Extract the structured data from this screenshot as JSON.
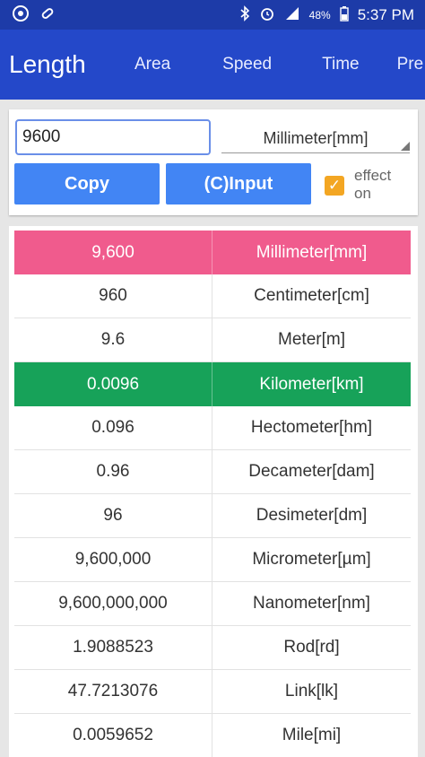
{
  "status": {
    "time": "5:37 PM",
    "battery": "48%",
    "left_icons": [
      "app-icon",
      "link-icon"
    ],
    "right_icons": [
      "bluetooth-icon",
      "alarm-icon",
      "signal-icon",
      "battery-icon"
    ]
  },
  "appbar": {
    "title": "Length",
    "tabs": [
      "Area",
      "Speed",
      "Time",
      "Pre"
    ]
  },
  "converter": {
    "input_value": "9600",
    "unit": "Millimeter[mm]",
    "copy_label": "Copy",
    "input_label": "(C)Input",
    "effect_label_1": "effect",
    "effect_label_2": "on",
    "effect_checked": true
  },
  "rows": [
    {
      "value": "9,600",
      "unit": "Millimeter[mm]",
      "highlight": "pink"
    },
    {
      "value": "960",
      "unit": "Centimeter[cm]",
      "highlight": ""
    },
    {
      "value": "9.6",
      "unit": "Meter[m]",
      "highlight": ""
    },
    {
      "value": "0.0096",
      "unit": "Kilometer[km]",
      "highlight": "green"
    },
    {
      "value": "0.096",
      "unit": "Hectometer[hm]",
      "highlight": ""
    },
    {
      "value": "0.96",
      "unit": "Decameter[dam]",
      "highlight": ""
    },
    {
      "value": "96",
      "unit": "Desimeter[dm]",
      "highlight": ""
    },
    {
      "value": "9,600,000",
      "unit": "Micrometer[µm]",
      "highlight": ""
    },
    {
      "value": "9,600,000,000",
      "unit": "Nanometer[nm]",
      "highlight": ""
    },
    {
      "value": "1.9088523",
      "unit": "Rod[rd]",
      "highlight": ""
    },
    {
      "value": "47.7213076",
      "unit": "Link[lk]",
      "highlight": ""
    },
    {
      "value": "0.0059652",
      "unit": "Mile[mi]",
      "highlight": ""
    }
  ],
  "colors": {
    "statusbar": "#1d3ba8",
    "appbar": "#2448c9",
    "button": "#4285f4",
    "pink_row": "#f05b8d",
    "green_row": "#17a259",
    "checkbox": "#f3a623"
  }
}
